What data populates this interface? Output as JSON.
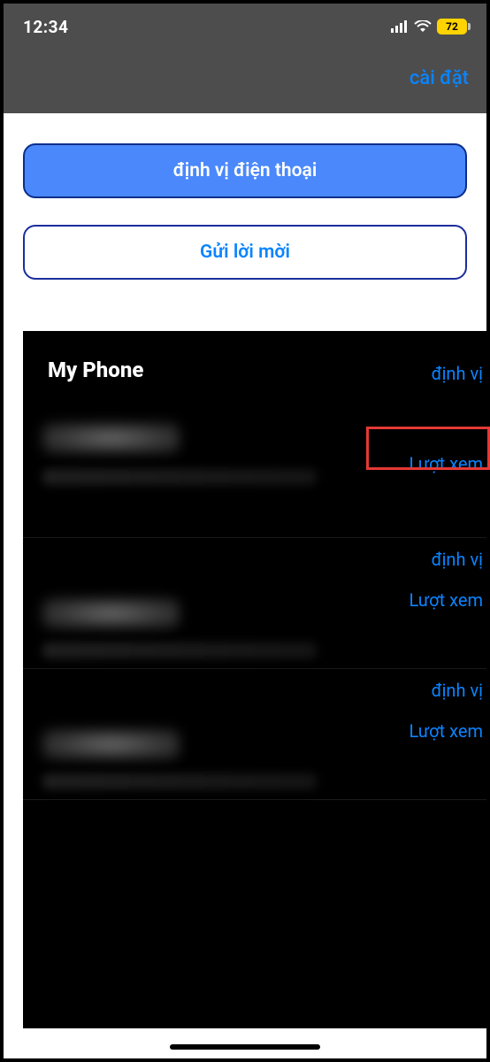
{
  "status": {
    "time": "12:34",
    "battery": "72"
  },
  "nav": {
    "settings": "cài đặt"
  },
  "buttons": {
    "locate_phone": "định vị điện thoại",
    "send_invite": "Gửi lời mời"
  },
  "panel": {
    "title": "My Phone",
    "top_locate": "định vị",
    "items": [
      {
        "locate": "định vị",
        "views": "Lượt xem"
      },
      {
        "locate": "định vị",
        "views": "Lượt xem"
      },
      {
        "locate": "định vị",
        "views": "Lượt xem"
      }
    ]
  }
}
